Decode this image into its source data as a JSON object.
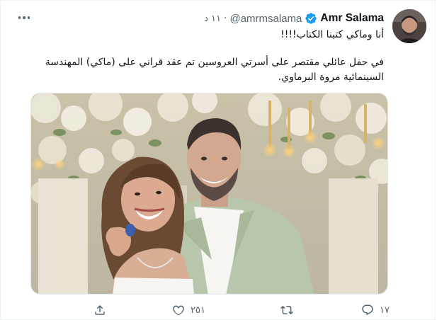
{
  "tweet": {
    "author_name": "Amr Salama",
    "handle": "@amrmsalama",
    "separator": "·",
    "time": "١١ د",
    "line1": "أنا وماكي كتبنا الكتاب!!!!",
    "body": "في حفل عائلي مقتصر على أسرتي العروسين تم عقد قراني على (ماكي) المهندسة السينمائية مروة البرماوي.",
    "replies": "١٧",
    "retweets": "",
    "likes": "٢٥١"
  },
  "colors": {
    "verified": "#1d9bf0",
    "text": "#0f1419",
    "muted": "#536471"
  },
  "icons": {
    "more": "more-icon",
    "verified": "verified-badge-icon",
    "reply": "reply-icon",
    "retweet": "retweet-icon",
    "like": "heart-icon",
    "share": "share-icon"
  }
}
